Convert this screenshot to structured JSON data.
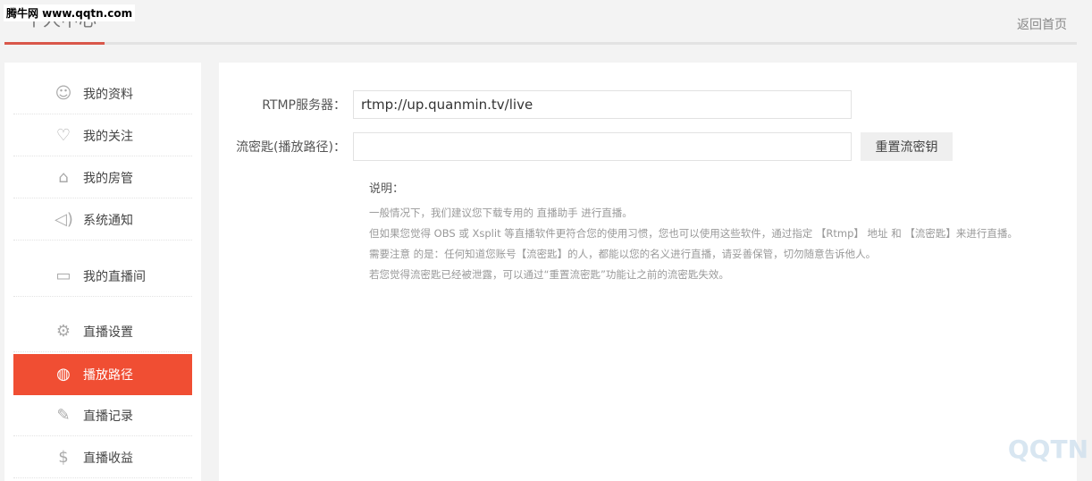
{
  "watermark": "腾牛网 www.qqtn.com",
  "header": {
    "title": "个人中心",
    "back_link": "返回首页"
  },
  "sidebar": {
    "items": [
      {
        "label": "我的资料",
        "icon": "user-icon"
      },
      {
        "label": "我的关注",
        "icon": "heart-icon"
      },
      {
        "label": "我的房管",
        "icon": "home-icon"
      },
      {
        "label": "系统通知",
        "icon": "speaker-icon"
      },
      {
        "label": "我的直播间",
        "icon": "video-icon"
      },
      {
        "label": "直播设置",
        "icon": "gear-icon"
      },
      {
        "label": "播放路径",
        "icon": "globe-icon",
        "active": true
      },
      {
        "label": "直播记录",
        "icon": "edit-icon"
      },
      {
        "label": "直播收益",
        "icon": "dollar-icon"
      }
    ]
  },
  "form": {
    "rtmp_label": "RTMP服务器：",
    "rtmp_value": "rtmp://up.quanmin.tv/live",
    "key_label": "流密匙(播放路径)：",
    "key_value": "",
    "reset_button": "重置流密钥"
  },
  "notes": {
    "title": "说明：",
    "lines": [
      "一般情况下，我们建议您下载专用的 直播助手 进行直播。",
      "但如果您觉得 OBS 或 Xsplit 等直播软件更符合您的使用习惯，您也可以使用这些软件，通过指定 【Rtmp】 地址 和 【流密匙】来进行直播。",
      "需要注意 的是：任何知道您账号【流密匙】的人，都能以您的名义进行直播，请妥善保管，切勿随意告诉他人。",
      "若您觉得流密匙已经被泄露，可以通过“重置流密匙”功能让之前的流密匙失效。"
    ]
  },
  "corner_logo": "QQTN"
}
